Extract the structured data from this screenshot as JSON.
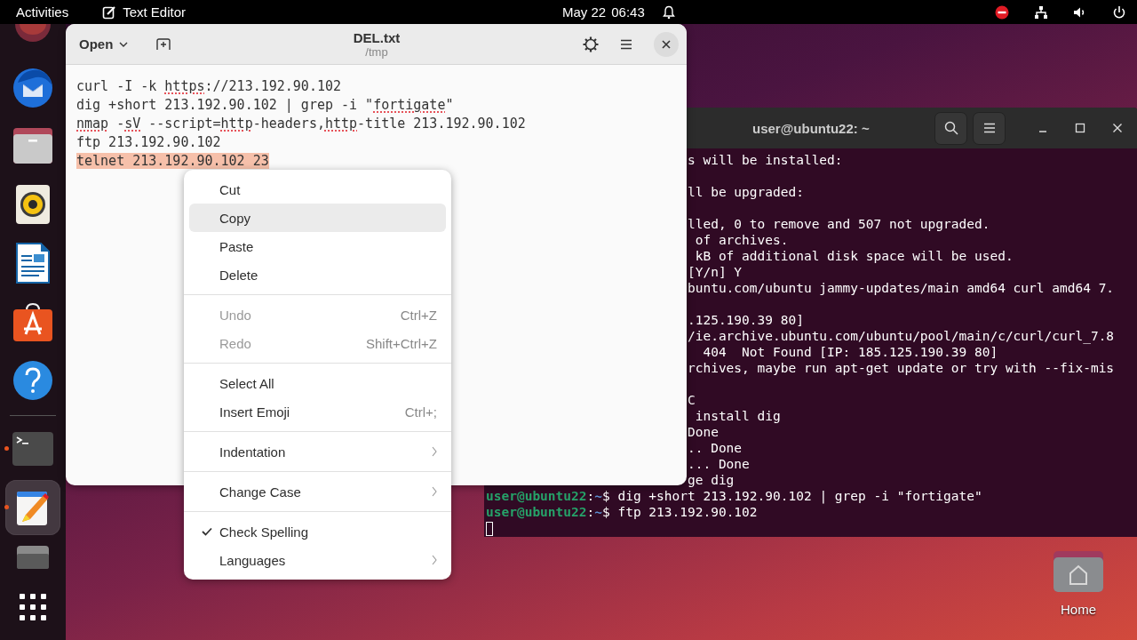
{
  "top_bar": {
    "activities": "Activities",
    "app_name": "Text Editor",
    "date": "May 22",
    "time": "06:43"
  },
  "dock": {
    "items": [
      {
        "kind": "partial",
        "running": false,
        "selected": false
      },
      {
        "kind": "mail",
        "running": false,
        "selected": false
      },
      {
        "kind": "files",
        "running": false,
        "selected": false
      },
      {
        "kind": "music",
        "running": false,
        "selected": false
      },
      {
        "kind": "writer",
        "running": false,
        "selected": false
      },
      {
        "kind": "store",
        "running": false,
        "selected": false
      },
      {
        "kind": "help",
        "running": false,
        "selected": false
      },
      {
        "kind": "separator"
      },
      {
        "kind": "terminal",
        "running": true,
        "selected": false
      },
      {
        "kind": "editor",
        "running": true,
        "selected": true
      },
      {
        "kind": "drive",
        "running": false,
        "selected": false
      },
      {
        "kind": "apps",
        "running": false,
        "selected": false
      }
    ]
  },
  "terminal": {
    "title": "user@ubuntu22: ~",
    "lines": [
      {
        "kind": "output",
        "text": "s will be installed:"
      },
      {
        "kind": "blank"
      },
      {
        "kind": "output",
        "text": "ll be upgraded:"
      },
      {
        "kind": "blank"
      },
      {
        "kind": "output",
        "text": "lled, 0 to remove and 507 not upgraded."
      },
      {
        "kind": "output",
        "text": " of archives."
      },
      {
        "kind": "output",
        "text": " kB of additional disk space will be used."
      },
      {
        "kind": "output",
        "text": "[Y/n] Y"
      },
      {
        "kind": "output",
        "text": "buntu.com/ubuntu jammy-updates/main amd64 curl amd64 7."
      },
      {
        "kind": "blank"
      },
      {
        "kind": "output",
        "text": ".125.190.39 80]"
      },
      {
        "kind": "output",
        "text": "/ie.archive.ubuntu.com/ubuntu/pool/main/c/curl/curl_7.8"
      },
      {
        "kind": "output",
        "text": "  404  Not Found [IP: 185.125.190.39 80]"
      },
      {
        "kind": "output",
        "text": "rchives, maybe run apt-get update or try with --fix-mis"
      },
      {
        "kind": "blank"
      },
      {
        "kind": "output",
        "text": "C"
      },
      {
        "kind": "output",
        "text": " install dig"
      },
      {
        "kind": "output",
        "text": "Done"
      },
      {
        "kind": "output",
        "text": ".. Done"
      },
      {
        "kind": "output",
        "text": "... Done"
      },
      {
        "kind": "output",
        "text": "ge dig"
      },
      {
        "kind": "prompt",
        "user": "user@ubuntu22",
        "separator": ":",
        "path": "~",
        "command": "$ dig +short 213.192.90.102 | grep -i \"fortigate\""
      },
      {
        "kind": "prompt",
        "user": "user@ubuntu22",
        "separator": ":",
        "path": "~",
        "command": "$ ftp 213.192.90.102"
      },
      {
        "kind": "cursor"
      }
    ]
  },
  "editor": {
    "open_button": "Open",
    "title": "DEL.txt",
    "subtitle": "/tmp",
    "lines": [
      {
        "selected": false,
        "segments": [
          {
            "text": "curl -I -k ",
            "misspelled": false
          },
          {
            "text": "https",
            "misspelled": true
          },
          {
            "text": "://213.192.90.102",
            "misspelled": false
          }
        ]
      },
      {
        "selected": false,
        "segments": [
          {
            "text": "dig +short 213.192.90.102 | grep -i \"",
            "misspelled": false
          },
          {
            "text": "fortigate",
            "misspelled": true
          },
          {
            "text": "\"",
            "misspelled": false
          }
        ]
      },
      {
        "selected": false,
        "segments": [
          {
            "text": "nmap",
            "misspelled": true
          },
          {
            "text": " -",
            "misspelled": false
          },
          {
            "text": "sV",
            "misspelled": true
          },
          {
            "text": " --script=",
            "misspelled": false
          },
          {
            "text": "http",
            "misspelled": true
          },
          {
            "text": "-headers,",
            "misspelled": false
          },
          {
            "text": "http",
            "misspelled": true
          },
          {
            "text": "-title 213.192.90.102",
            "misspelled": false
          }
        ]
      },
      {
        "selected": false,
        "segments": [
          {
            "text": "ftp 213.192.90.102",
            "misspelled": false
          }
        ]
      },
      {
        "selected": true,
        "segments": [
          {
            "text": "telnet 213.192.90.102 23",
            "misspelled": false
          }
        ]
      }
    ]
  },
  "context_menu": {
    "sections": [
      [
        {
          "kind": "action",
          "label": "Cut",
          "disabled": false,
          "selected": false
        },
        {
          "kind": "action",
          "label": "Copy",
          "disabled": false,
          "selected": true
        },
        {
          "kind": "action",
          "label": "Paste",
          "disabled": false,
          "selected": false
        },
        {
          "kind": "action",
          "label": "Delete",
          "disabled": false,
          "selected": false
        }
      ],
      [
        {
          "kind": "action",
          "label": "Undo",
          "shortcut": "Ctrl+Z",
          "disabled": true,
          "selected": false
        },
        {
          "kind": "action",
          "label": "Redo",
          "shortcut": "Shift+Ctrl+Z",
          "disabled": true,
          "selected": false
        }
      ],
      [
        {
          "kind": "action",
          "label": "Select All",
          "disabled": false,
          "selected": false
        },
        {
          "kind": "action",
          "label": "Insert Emoji",
          "shortcut": "Ctrl+;",
          "disabled": false,
          "selected": false
        }
      ],
      [
        {
          "kind": "submenu",
          "label": "Indentation",
          "disabled": false,
          "selected": false
        }
      ],
      [
        {
          "kind": "submenu",
          "label": "Change Case",
          "disabled": false,
          "selected": false
        }
      ],
      [
        {
          "kind": "check",
          "label": "Check Spelling",
          "checked": true,
          "disabled": false,
          "selected": false
        },
        {
          "kind": "submenu",
          "label": "Languages",
          "disabled": false,
          "selected": false
        }
      ]
    ]
  },
  "desktop_icons": [
    {
      "label": "Home"
    }
  ]
}
